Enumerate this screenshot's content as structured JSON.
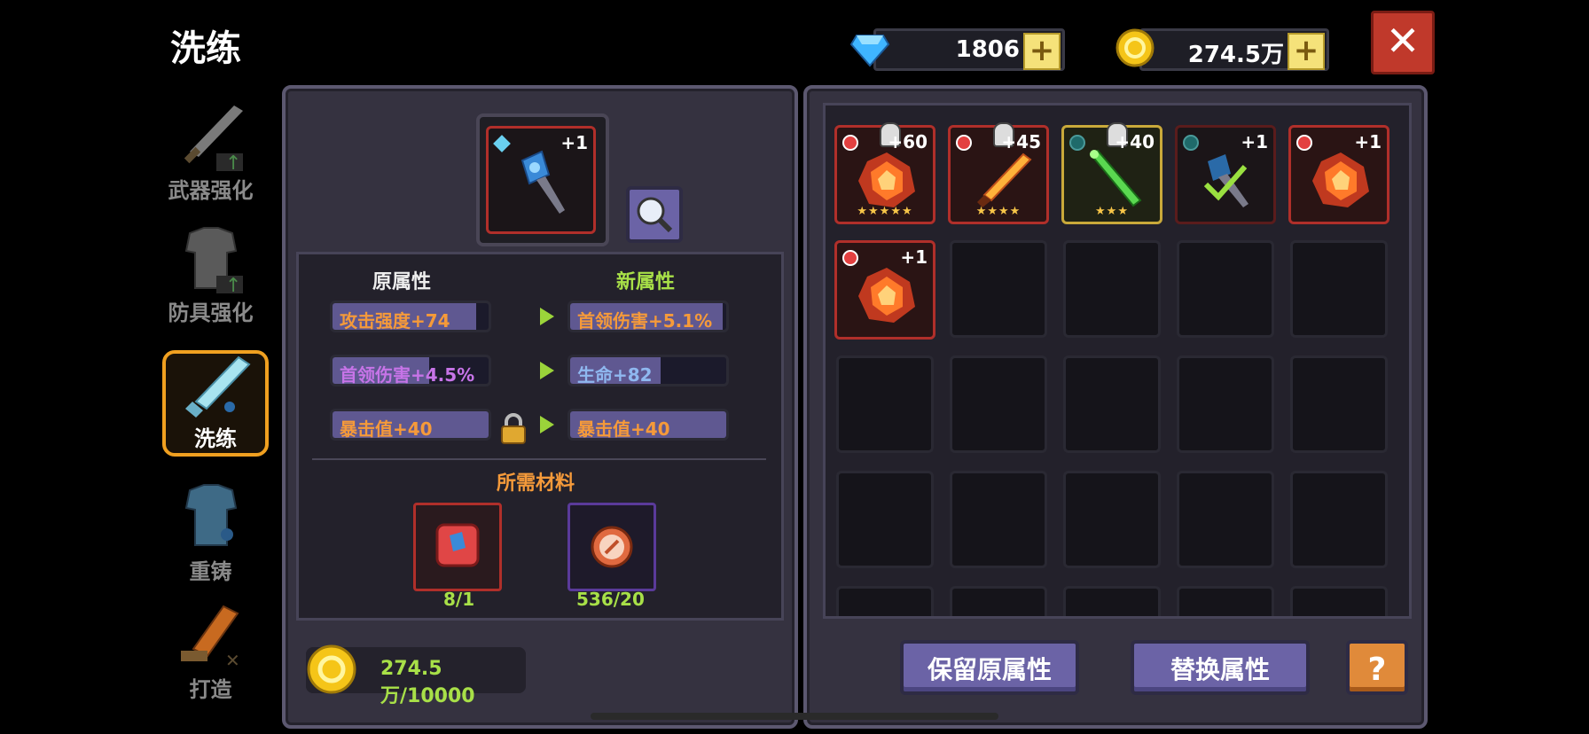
{
  "title": "洗练",
  "currency": {
    "gems": "1806",
    "gold": "274.5万"
  },
  "sidebar": {
    "items": [
      {
        "label": "武器强化"
      },
      {
        "label": "防具强化"
      },
      {
        "label": "洗练"
      },
      {
        "label": "重铸"
      },
      {
        "label": "打造"
      }
    ]
  },
  "selected": {
    "level": "+1"
  },
  "attr": {
    "old_header": "原属性",
    "new_header": "新属性",
    "old": [
      {
        "text": "攻击强度+74",
        "color": "#f59a3a",
        "fill": 0.92
      },
      {
        "text": "首领伤害+4.5%",
        "color": "#c774e8",
        "fill": 0.62
      },
      {
        "text": "暴击值+40",
        "color": "#f59a3a",
        "fill": 1.0
      }
    ],
    "new": [
      {
        "text": "首领伤害+5.1%",
        "color": "#f59a3a",
        "fill": 0.98
      },
      {
        "text": "生命+82",
        "color": "#8fb8f0",
        "fill": 0.58
      },
      {
        "text": "暴击值+40",
        "color": "#f59a3a",
        "fill": 1.0
      }
    ]
  },
  "materials": {
    "header": "所需材料",
    "items": [
      {
        "count": "8/1"
      },
      {
        "count": "536/20"
      }
    ]
  },
  "cost": {
    "text": "274.5万/10000"
  },
  "inventory": [
    {
      "level": "+60",
      "stars": "★★★★★"
    },
    {
      "level": "+45",
      "stars": "★★★★"
    },
    {
      "level": "+40",
      "stars": "★★★"
    },
    {
      "level": "+1",
      "stars": ""
    },
    {
      "level": "+1",
      "stars": ""
    },
    {
      "level": "+1",
      "stars": ""
    }
  ],
  "buttons": {
    "keep": "保留原属性",
    "replace": "替换属性",
    "help": "?"
  },
  "colors": {
    "accent_gold": "#f0a020",
    "button": "#6b63a6",
    "close": "#c0392b"
  }
}
